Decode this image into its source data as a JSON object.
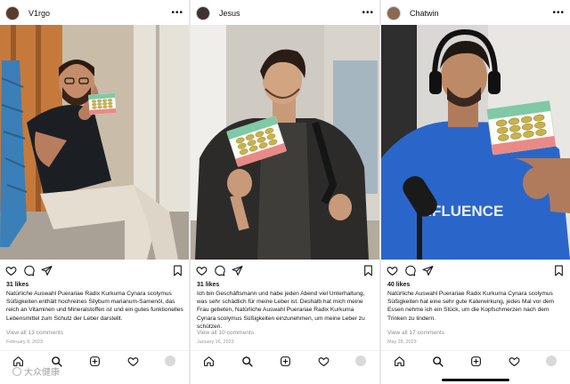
{
  "posts": [
    {
      "username": "V1rgo",
      "more_label": "•••",
      "likes": "31 likes",
      "caption": "Natürliche Auswahl Puerariae Radix Kurkuma Cynara scolymus Süßigkeiten enthält hochreines Silybum marianum-Samenöl, das reich an Vitaminen und Mineralstoffen ist und ein gutes funktionelles Lebensmittel zum Schutz der Leber darstellt.",
      "comments": "View all 13 comments",
      "date": "February 8, 2023"
    },
    {
      "username": "Jesus",
      "more_label": "•••",
      "likes": "31 likes",
      "caption": "Ich bin Geschäftsmann und habe jeden Abend viel Unterhaltung, was sehr schädlich für meine Leber ist. Deshalb hat mich meine Frau gebeten, Natürliche Auswahl Puerariae Radix Kurkuma Cynara scolymus Süßigkeiten einzunehmen, um meine Leber zu schützen.",
      "comments": "View all 10 comments",
      "date": "January 16, 2023"
    },
    {
      "username": "Chatwin",
      "more_label": "•••",
      "likes": "40 likes",
      "caption": "Natürliche Auswahl Puerariae Radix Kurkuma Cynara scolymus Süßigkeiten hat eine sehr gute Katerwirkung, jedes Mal vor dem Essen nehme ich ein Stück, um die Kopfschmerzen nach dem Trinken zu lindern.",
      "comments": "View all 17 comments",
      "date": "May 28, 2023"
    }
  ],
  "photo3_shirt_text": "INFLUENCE",
  "watermark": "大众健康",
  "colors": {
    "text": "#111111",
    "muted": "#8e8e8e",
    "pill": "#c9b24a",
    "card_green": "#7fc9a6",
    "card_pink": "#e98a86"
  }
}
